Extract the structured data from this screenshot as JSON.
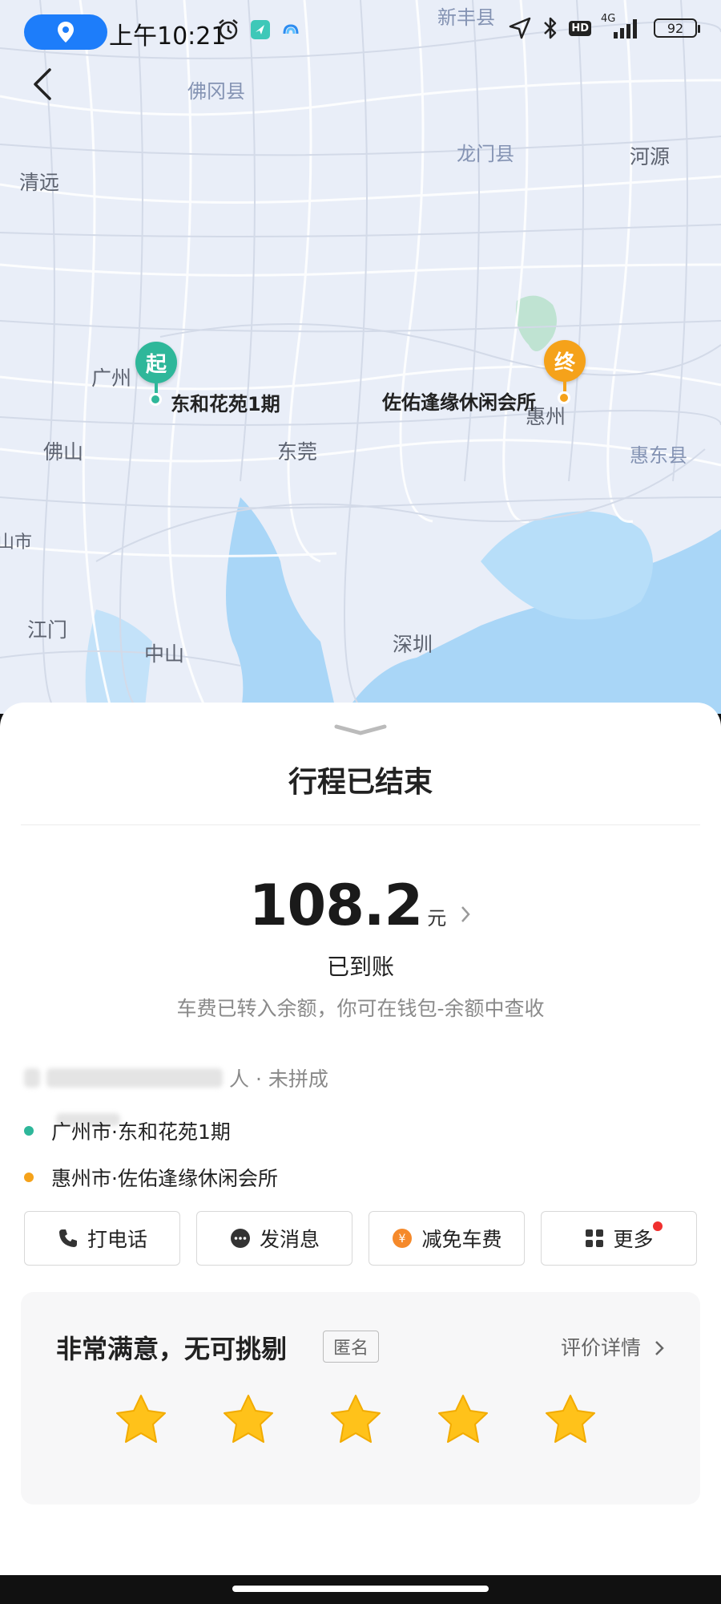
{
  "status_bar": {
    "time": "上午10:21",
    "battery": "92",
    "network": "4G",
    "hd": "HD"
  },
  "map": {
    "labels": {
      "xinfeng": "新丰县",
      "fogang": "佛冈县",
      "longmen": "龙门县",
      "heyuan": "河源",
      "qingyuan": "清远",
      "guangzhou": "广州",
      "foshan": "佛山",
      "dongguan": "东莞",
      "huizhou": "惠州",
      "huidong": "惠东县",
      "jiangmen": "江门",
      "zhongshan": "中山",
      "shenzhen": "深圳",
      "shan_shi": "山市"
    },
    "start_marker": "起",
    "end_marker": "终",
    "start_name": "东和花苑1期",
    "end_name": "佐佑逢缘休闲会所"
  },
  "sheet": {
    "title": "行程已结束",
    "amount": "108.2",
    "unit": "元",
    "paid_status": "已到账",
    "paid_note": "车费已转入余额，你可在钱包-余额中查收",
    "trip_meta": "人 · 未拼成",
    "origin": "广州市·东和花苑1期",
    "destination": "惠州市·佐佑逢缘休闲会所",
    "actions": {
      "call": "打电话",
      "message": "发消息",
      "waive": "减免车费",
      "more": "更多"
    },
    "rating": {
      "title": "非常满意，无可挑剔",
      "anonymous": "匿名",
      "detail": "评价详情",
      "stars": 5,
      "max_stars": 5
    }
  },
  "colors": {
    "start": "#2eb79a",
    "end": "#f5a21a",
    "accent": "#1d7dfa",
    "water": "#a9d6f7",
    "star": "#ffc21a"
  }
}
